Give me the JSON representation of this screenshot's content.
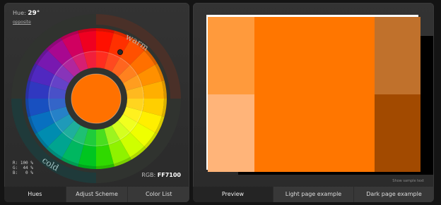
{
  "hue": {
    "label": "Hue:",
    "value": "29°",
    "opposite_link": "opposite"
  },
  "wheel": {
    "warm_label": "warm",
    "cold_label": "cold",
    "center_color": "#FF7100",
    "marker_color": "#2a2a2a"
  },
  "rgb": {
    "r_line": "R: 100 %",
    "g_line": "G:  44 %",
    "b_line": "B:   0 %",
    "hex_label": "RGB:",
    "hex_value": "FF7100"
  },
  "left_tabs": [
    {
      "label": "Hues",
      "active": true
    },
    {
      "label": "Adjust Scheme",
      "active": false
    },
    {
      "label": "Color List",
      "active": false
    }
  ],
  "right_tabs": [
    {
      "label": "Preview",
      "active": true
    },
    {
      "label": "Light page example",
      "active": false
    },
    {
      "label": "Dark page example",
      "active": false
    }
  ],
  "preview": {
    "colors": {
      "main": "#FF7600",
      "light": "#FF9A3C",
      "lighter": "#FFB479",
      "dark": "#C0712C",
      "darker": "#A24A00"
    },
    "sample_text_link": "Show sample text"
  }
}
